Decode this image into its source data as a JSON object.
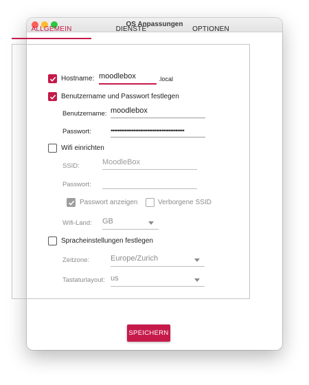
{
  "window": {
    "title": "OS Anpassungen"
  },
  "tabs": [
    {
      "label": "ALLGEMEIN"
    },
    {
      "label": "DIENSTE"
    },
    {
      "label": "OPTIONEN"
    }
  ],
  "general": {
    "hostname": {
      "label": "Hostname:",
      "value": "moodlebox",
      "suffix": ".local",
      "checked": true
    },
    "user": {
      "label": "Benutzername und Passwort festlegen",
      "checked": true,
      "username_label": "Benutzername:",
      "username_value": "moodlebox",
      "password_label": "Passwort:",
      "password_value": "••••••••••••••••••••••••••••••••••••••••••"
    },
    "wifi": {
      "label": "Wifi einrichten",
      "checked": false,
      "ssid_label": "SSID:",
      "ssid_value": "MoodleBox",
      "password_label": "Passwort:",
      "password_value": "",
      "show_password_label": "Passwort anzeigen",
      "show_password_checked": true,
      "hidden_ssid_label": "Verborgene SSID",
      "hidden_ssid_checked": false,
      "country_label": "Wifi-Land:",
      "country_value": "GB"
    },
    "locale": {
      "label": "Spracheinstellungen festlegen",
      "checked": false,
      "timezone_label": "Zeitzone:",
      "timezone_value": "Europe/Zurich",
      "keyboard_label": "Tastaturlayout:",
      "keyboard_value": "us"
    }
  },
  "actions": {
    "save_label": "SPEICHERN"
  },
  "colors": {
    "accent": "#c51a4a",
    "disabled": "#9e9e9e"
  },
  "icons": {
    "check": "checkmark-icon",
    "dropdown": "dropdown-arrow-icon"
  }
}
